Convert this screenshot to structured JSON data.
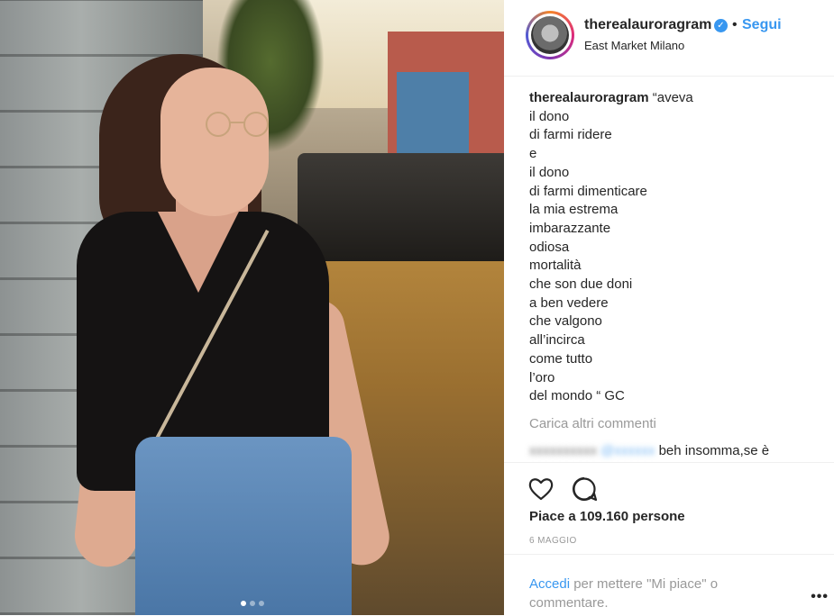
{
  "post": {
    "carousel": {
      "count": 3,
      "active_index": 0
    },
    "header": {
      "username": "therealauroragram",
      "verified": true,
      "separator": "•",
      "follow_label": "Segui",
      "location": "East Market Milano"
    },
    "caption": {
      "username": "therealauroragram",
      "first_line": "“aveva",
      "lines": [
        "il dono",
        "di farmi ridere",
        "e",
        "il dono",
        "di farmi dimenticare",
        "la mia estrema",
        "imbarazzante",
        "odiosa",
        "mortalità",
        "che son due doni",
        "a ben vedere",
        "che valgono",
        "all’incirca",
        "come tutto",
        "l’oro",
        "del mondo “ GC"
      ]
    },
    "load_more_label": "Carica altri commenti",
    "comment": {
      "text": "beh insomma,se è"
    },
    "actions": {
      "like_icon": "heart-icon",
      "comment_icon": "comment-icon"
    },
    "likes_text": "Piace a 109.160 persone",
    "date": "6 MAGGIO",
    "login_prompt": {
      "link": "Accedi",
      "rest": " per mettere \"Mi piace\" o commentare."
    },
    "more_label": "•••"
  }
}
